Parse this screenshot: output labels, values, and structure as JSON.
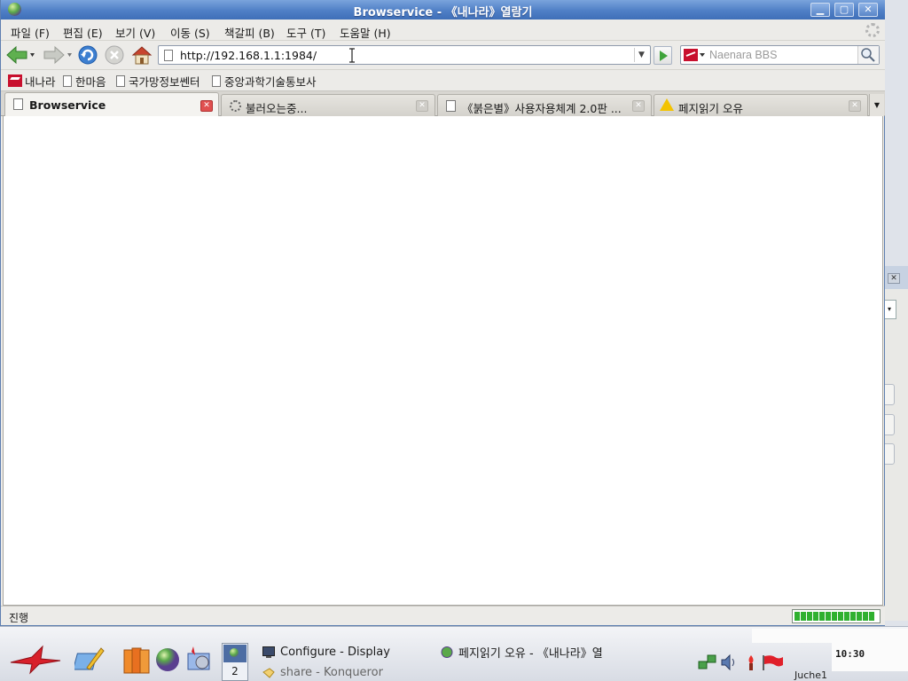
{
  "window": {
    "title": "Browservice - 《내나라》열람기",
    "minimize_label": "▁",
    "maximize_label": "▢",
    "close_label": "✕"
  },
  "menu": {
    "items": [
      {
        "label": "파일 (F)"
      },
      {
        "label": "편집 (E)"
      },
      {
        "label": "보기 (V)"
      },
      {
        "label": "이동 (S)"
      },
      {
        "label": "책갈피 (B)"
      },
      {
        "label": "도구 (T)"
      },
      {
        "label": "도움말 (H)"
      }
    ]
  },
  "navigation": {
    "url": "http://192.168.1.1:1984/",
    "search_placeholder": "Naenara BBS"
  },
  "bookmarks": [
    {
      "label": "내나라",
      "icon": "naenara-flag-icon"
    },
    {
      "label": "한마음",
      "icon": "page-icon"
    },
    {
      "label": "국가망정보쎈터",
      "icon": "page-icon"
    },
    {
      "label": "중앙과학기술통보사",
      "icon": "page-icon"
    }
  ],
  "tabs": [
    {
      "label": "Browservice",
      "icon": "page-icon",
      "active": true
    },
    {
      "label": "불러오는중...",
      "icon": "loading-icon",
      "active": false
    },
    {
      "label": "《붉은별》사용자용체계 2.0판 ...",
      "icon": "page-icon",
      "active": false
    },
    {
      "label": "페지읽기 오유",
      "icon": "warning-icon",
      "active": false
    }
  ],
  "status": {
    "text": "진행",
    "progress_percent": 100
  },
  "taskbar": {
    "pager_number": "2",
    "tasks": [
      {
        "label": "Configure - Display"
      },
      {
        "label": "share - Konqueror"
      },
      {
        "label": "페지읽기 오유 - 《내나라》열"
      }
    ],
    "clock": "10:30",
    "user_label": "Juche1"
  },
  "colors": {
    "titlebar": "#4f7fc6",
    "progress": "#2fb02f",
    "active_tab_close": "#e05050"
  }
}
